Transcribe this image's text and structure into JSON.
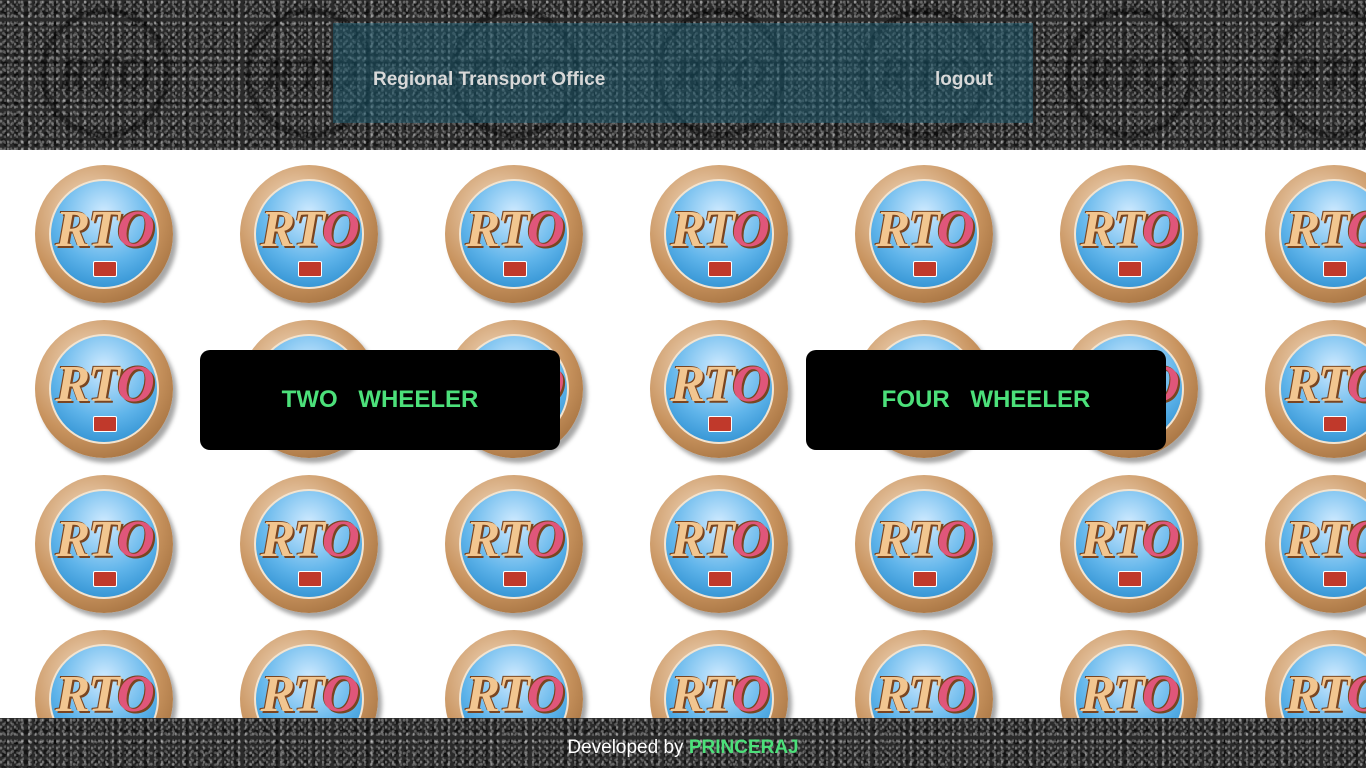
{
  "header": {
    "title": "Regional Transport Office",
    "logout_label": "logout"
  },
  "logo_text": {
    "r": "R",
    "t": "T",
    "o": "O"
  },
  "main": {
    "two_wheeler_label": "TWO WHEELER",
    "four_wheeler_label": "FOUR WHEELER"
  },
  "footer": {
    "prefix": "Developed by",
    "author": "PRINCERAJ"
  },
  "colors": {
    "accent_green": "#4ce07a",
    "nav_overlay": "#1e5a6e",
    "button_bg": "#000000"
  }
}
